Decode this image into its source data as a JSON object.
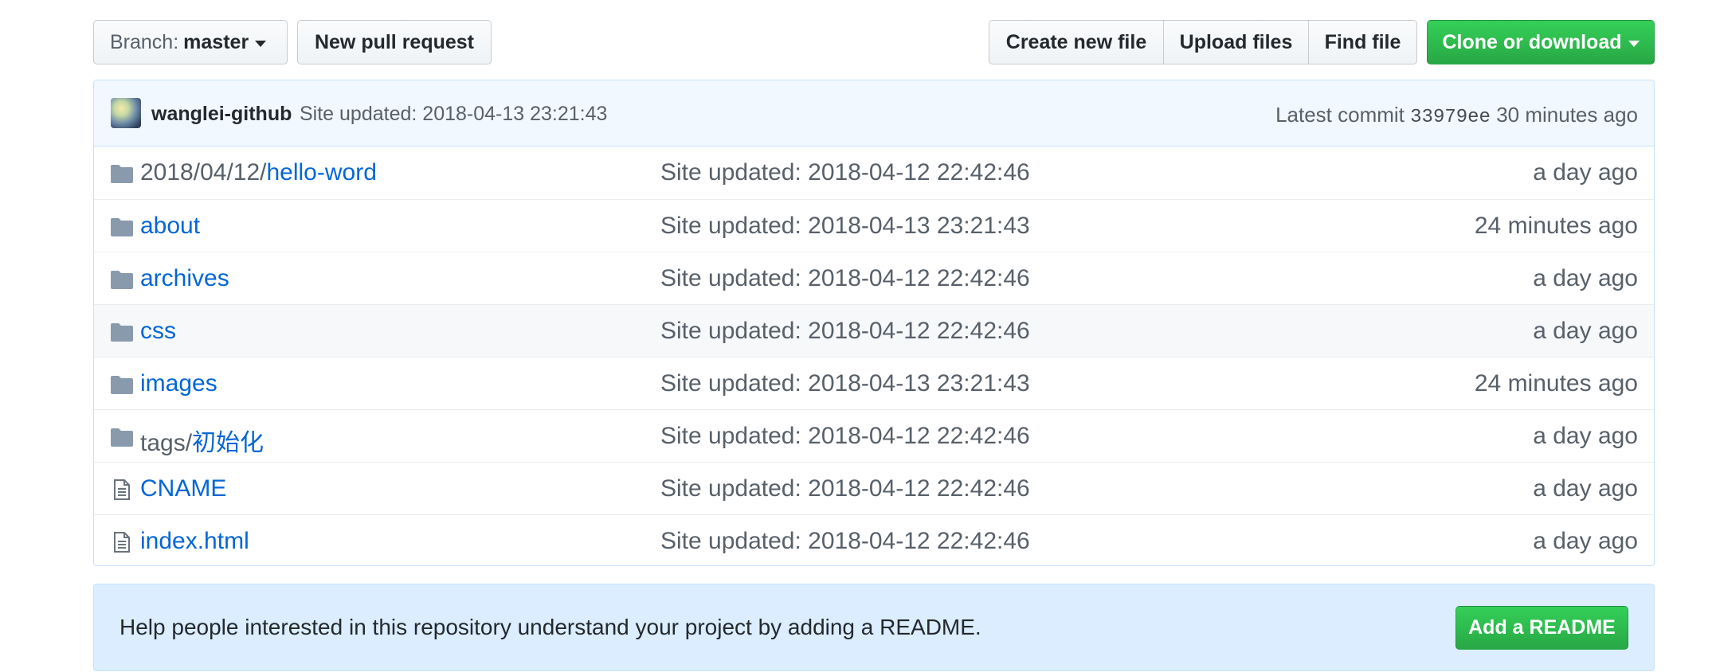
{
  "toolbar": {
    "branch_prefix": "Branch:",
    "branch_name": "master",
    "new_pull_request": "New pull request",
    "create_new_file": "Create new file",
    "upload_files": "Upload files",
    "find_file": "Find file",
    "clone_or_download": "Clone or download"
  },
  "commit": {
    "author": "wanglei-github",
    "message": "Site updated: 2018-04-13 23:21:43",
    "latest_label": "Latest commit",
    "sha": "33979ee",
    "age": "30 minutes ago"
  },
  "files": [
    {
      "type": "folder",
      "icon": "folder-icon",
      "path": "2018/04/12/",
      "name": "hello-word",
      "message": "Site updated: 2018-04-12 22:42:46",
      "age": "a day ago"
    },
    {
      "type": "folder",
      "icon": "folder-icon",
      "path": "",
      "name": "about",
      "message": "Site updated: 2018-04-13 23:21:43",
      "age": "24 minutes ago"
    },
    {
      "type": "folder",
      "icon": "folder-icon",
      "path": "",
      "name": "archives",
      "message": "Site updated: 2018-04-12 22:42:46",
      "age": "a day ago"
    },
    {
      "type": "folder",
      "icon": "folder-icon",
      "path": "",
      "name": "css",
      "message": "Site updated: 2018-04-12 22:42:46",
      "age": "a day ago"
    },
    {
      "type": "folder",
      "icon": "folder-icon",
      "path": "",
      "name": "images",
      "message": "Site updated: 2018-04-13 23:21:43",
      "age": "24 minutes ago"
    },
    {
      "type": "folder",
      "icon": "folder-icon",
      "path": "tags/",
      "name": "初始化",
      "message": "Site updated: 2018-04-12 22:42:46",
      "age": "a day ago"
    },
    {
      "type": "file",
      "icon": "file-icon",
      "path": "",
      "name": "CNAME",
      "message": "Site updated: 2018-04-12 22:42:46",
      "age": "a day ago"
    },
    {
      "type": "file",
      "icon": "file-icon",
      "path": "",
      "name": "index.html",
      "message": "Site updated: 2018-04-12 22:42:46",
      "age": "a day ago"
    }
  ],
  "readme": {
    "text": "Help people interested in this repository understand your project by adding a README.",
    "button": "Add a README"
  },
  "colors": {
    "link": "#0366d6",
    "green_button": "#28a745",
    "commit_bar_bg": "#f1f8ff",
    "readme_bg": "#dbedff",
    "muted_text": "#586069",
    "folder_icon": "#79b8ff"
  }
}
